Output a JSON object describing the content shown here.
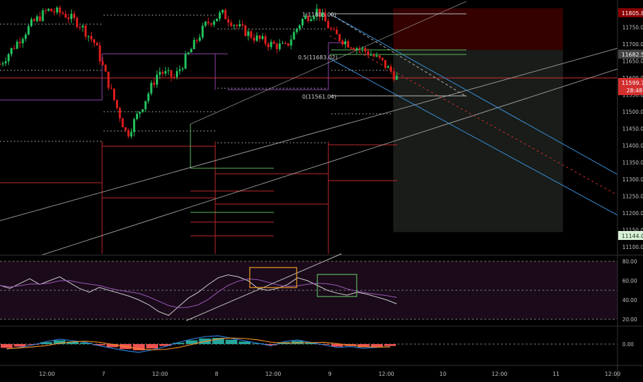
{
  "colors": {
    "background": "#000000",
    "up_candle": "#22c55e",
    "down_candle": "#e11d1d",
    "current_price_tag": "#d32f2f",
    "fib_line": "#cfcfcf",
    "channel_line": "#3b8fd6",
    "rsi_line": "#cfcfcf",
    "rsi_ma": "#9b59b6",
    "rsi_band": "#1a0a1a",
    "stop_zone": "#3a0000",
    "target_zone": "#1a1d1a",
    "macd_line": "#2f7ed8",
    "signal_line": "#f08a24",
    "hist_up": "#26a69a",
    "hist_down": "#ef5350",
    "box_orange": "#f0a020",
    "box_green": "#5cb85c"
  },
  "price_axis": {
    "ticks": [
      "11750.00",
      "11700.00",
      "11650.00",
      "11600.00",
      "11550.00",
      "11500.00",
      "11450.00",
      "11400.00",
      "11350.00",
      "11300.00",
      "11250.00",
      "11200.00",
      "11150.00",
      "11100.00"
    ],
    "tags": {
      "top_price": "11805.89",
      "entry_price": "11682.56",
      "current_price": "11599.78",
      "countdown": "28:48",
      "target_price": "11144.02"
    }
  },
  "fib_labels": {
    "level_1": "1(11805.00)",
    "level_05": "0.5(11683.02)",
    "level_0": "0(11561.04)"
  },
  "rsi_axis": {
    "ticks": [
      "80.00",
      "60.00",
      "40.00",
      "20.00"
    ]
  },
  "macd_axis": {
    "ticks": [
      "0.00"
    ]
  },
  "time_axis": {
    "ticks": [
      "12:00",
      "7",
      "12:00",
      "8",
      "12:00",
      "9",
      "12:00",
      "10",
      "12:00",
      "11",
      "12:00"
    ]
  },
  "chart_data": [
    {
      "type": "candlestick",
      "panel": "price",
      "ylim": [
        11080,
        11830
      ],
      "x_ticks": [
        "12:00",
        "7",
        "12:00",
        "8",
        "12:00",
        "9",
        "12:00",
        "10",
        "12:00",
        "11",
        "12:00"
      ],
      "approx_close_path": [
        11640,
        11700,
        11760,
        11800,
        11790,
        11760,
        11700,
        11560,
        11430,
        11520,
        11620,
        11600,
        11680,
        11760,
        11790,
        11750,
        11720,
        11700,
        11690,
        11770,
        11800,
        11730,
        11700,
        11680,
        11650,
        11600
      ],
      "current_price": 11599.78,
      "fib_levels": [
        {
          "ratio": 1,
          "price": 11805.0
        },
        {
          "ratio": 0.5,
          "price": 11683.02
        },
        {
          "ratio": 0,
          "price": 11561.04
        }
      ],
      "position": {
        "entry": 11682.56,
        "stop": 11805.89,
        "target": 11144.02
      }
    },
    {
      "type": "line",
      "panel": "rsi",
      "ylim": [
        15,
        85
      ],
      "guide_levels": [
        80,
        50,
        20
      ],
      "approx_values": [
        55,
        52,
        57,
        62,
        56,
        60,
        64,
        58,
        52,
        48,
        53,
        50,
        47,
        44,
        40,
        35,
        28,
        24,
        33,
        42,
        48,
        56,
        63,
        66,
        64,
        60,
        52,
        50,
        52,
        56,
        63,
        60,
        55,
        50,
        47,
        45,
        48,
        46,
        43,
        40,
        36
      ]
    },
    {
      "type": "bar",
      "panel": "macd",
      "zero_line": 0,
      "approx_histogram": [
        -0.6,
        -0.4,
        -0.1,
        0.3,
        0.6,
        0.4,
        0.2,
        -0.2,
        -0.5,
        -0.8,
        -1.0,
        -0.7,
        -0.3,
        0.2,
        0.6,
        0.9,
        1.0,
        0.7,
        0.4,
        0.1,
        -0.2,
        0.3,
        0.5,
        0.2,
        -0.1,
        -0.4,
        -0.3,
        -0.5,
        -0.4,
        -0.3
      ]
    }
  ]
}
